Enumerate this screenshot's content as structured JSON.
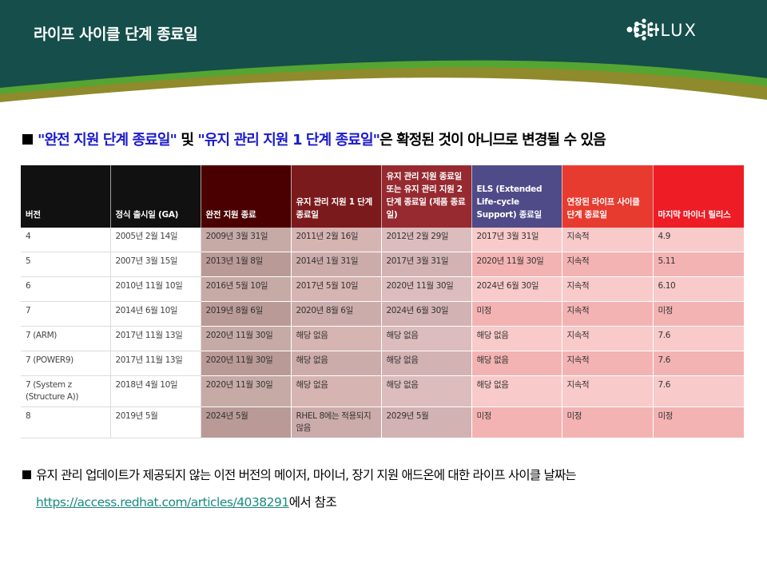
{
  "header": {
    "title": "라이프 사이클 단계 종료일",
    "logo_text": "CHLUX",
    "colors": {
      "dark": "#154e4b",
      "green": "#55a532",
      "olive": "#8f8a2c"
    }
  },
  "note": {
    "part1": "\"완전 지원 단계 종료일\"",
    "part2": " 및 ",
    "part3": "\"유지 관리 지원 1 단계 종료일\"",
    "part4": "은 확정된 것이 아니므로 변경될 수 있음"
  },
  "table": {
    "headers": [
      "버전",
      "정식 출시일 (GA)",
      "완전 지원 종료",
      "유지 관리 지원 1 단계 종료일",
      "유지 관리 지원 종료일 또는 유지 관리 지원 2 단계 종료일 (제품 종료일)",
      "ELS (Extended Life-cycle Support) 종료일",
      "연장된 라이프 사이클 단계 종료일",
      "마지막 마이너 릴리스"
    ],
    "header_colors": [
      "#111111",
      "#111111",
      "#4a0000",
      "#7b1a1c",
      "#962a30",
      "#4f4a88",
      "#e83b30",
      "#ee1c25"
    ],
    "rows": [
      [
        "4",
        "2005년 2월 14일",
        "2009년 3월 31일",
        "2011년 2월 16일",
        "2012년 2월 29일",
        "2017년 3월 31일",
        "지속적",
        "4.9"
      ],
      [
        "5",
        "2007년 3월 15일",
        "2013년 1월 8일",
        "2014년 1월 31일",
        "2017년 3월 31일",
        "2020년 11월 30일",
        "지속적",
        "5.11"
      ],
      [
        "6",
        "2010년 11월 10일",
        "2016년 5월 10일",
        "2017년 5월 10일",
        "2020년 11월 30일",
        "2024년 6월 30일",
        "지속적",
        "6.10"
      ],
      [
        "7",
        "2014년 6월 10일",
        "2019년 8월 6일",
        "2020년 8월 6일",
        "2024년 6월 30일",
        "미정",
        "지속적",
        "미정"
      ],
      [
        "7 (ARM)",
        "2017년 11월 13일",
        "2020년 11월 30일",
        "해당 없음",
        "해당 없음",
        "해당 없음",
        "지속적",
        "7.6"
      ],
      [
        "7 (POWER9)",
        "2017년 11월 13일",
        "2020년 11월 30일",
        "해당 없음",
        "해당 없음",
        "해당 없음",
        "지속적",
        "7.6"
      ],
      [
        "7 (System z (Structure A))",
        "2018년 4월 10일",
        "2020년 11월 30일",
        "해당 없음",
        "해당 없음",
        "해당 없음",
        "지속적",
        "7.6"
      ],
      [
        "8",
        "2019년 5월",
        "2024년 5월",
        "RHEL 8에는 적용되지 않음",
        "2029년 5월",
        "미정",
        "미정",
        "미정"
      ]
    ]
  },
  "footer": {
    "line1": "유지 관리 업데이트가 제공되지 않는 이전 버전의 메이저, 마이너, 장기 지원 애드온에 대한 라이프 사이클 날짜는",
    "link": "https://access.redhat.com/articles/4038291",
    "line2_suffix": "에서 참조"
  }
}
